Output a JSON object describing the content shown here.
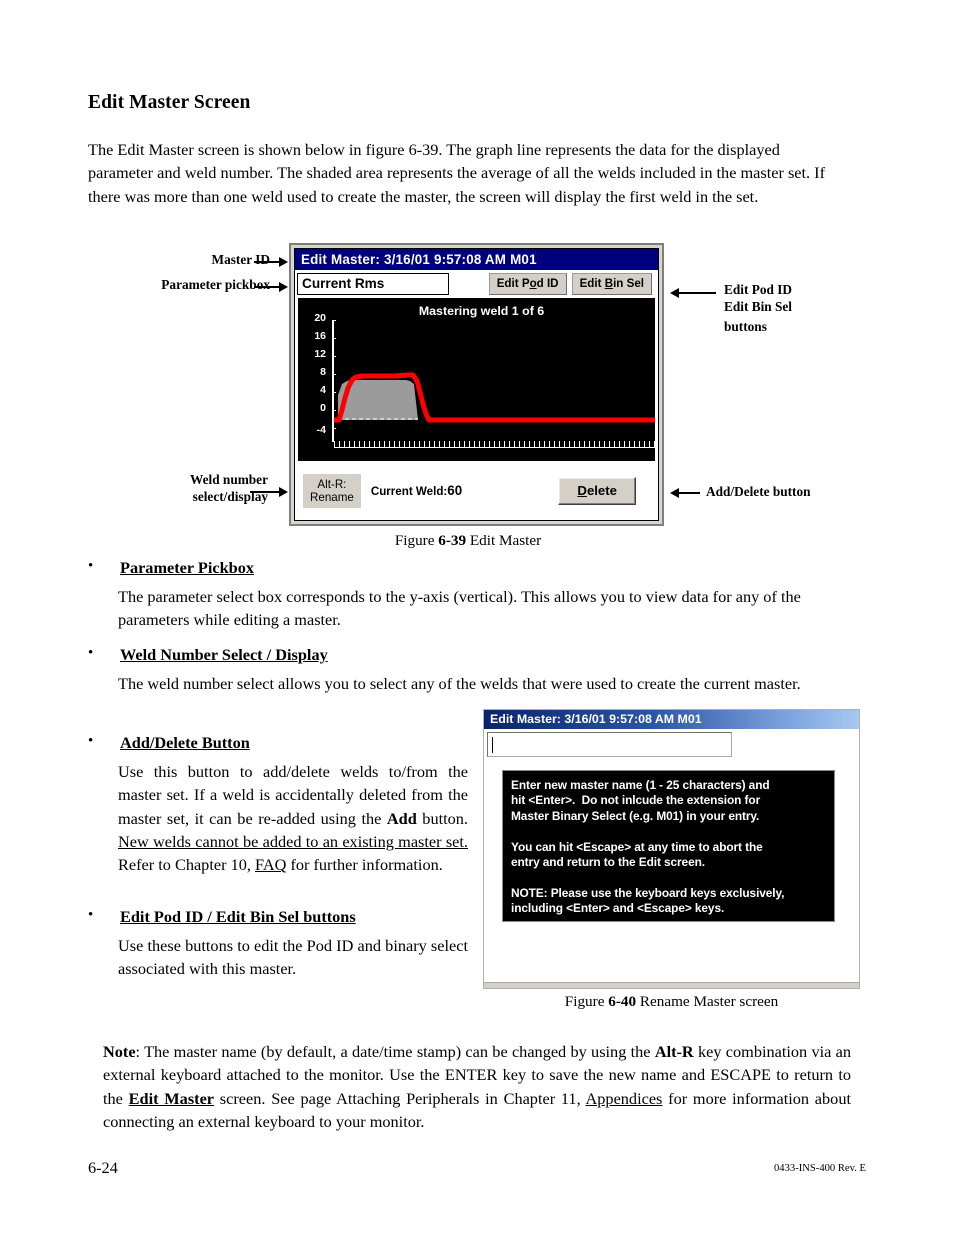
{
  "page": {
    "heading": "Edit Master Screen",
    "intro": "The Edit Master screen is shown below in figure 6-39. The graph line represents the data for the displayed parameter and weld number.  The shaded area represents the average of all the welds included in the master set. If there was more than one weld used to create the master, the screen will display the first weld in the set.",
    "footer_page": "6-24",
    "footer_doc": "0433-INS-400 Rev. E"
  },
  "callouts": {
    "master_id": "Master ID",
    "parameter_pickbox": "Parameter pickbox",
    "weld_number_line1": "Weld  number",
    "weld_number_line2": "select/display",
    "edit_pod_line1": "Edit Pod ID",
    "edit_pod_line2": "Edit Bin Sel",
    "edit_pod_line3": "buttons",
    "add_delete": "Add/Delete button"
  },
  "figure1": {
    "title": "Edit Master: 3/16/01 9:57:08 AM M01",
    "pickbox_value": "Current Rms",
    "btn_pod_pre": "Edit P",
    "btn_pod_key": "o",
    "btn_pod_post": "d ID",
    "btn_bin_pre": "Edit ",
    "btn_bin_key": "B",
    "btn_bin_post": "in Sel",
    "rename_line1": "Alt-R:",
    "rename_line2": "Rename",
    "current_weld_label": "Current Weld:",
    "current_weld_value": "60",
    "delete_key": "D",
    "delete_rest": "elete",
    "caption_prefix": "Figure ",
    "caption_number": "6-39",
    "caption_text": " Edit Master"
  },
  "chart_data": {
    "type": "line",
    "title": "Mastering weld 1 of 6",
    "xlabel": "",
    "ylabel": "",
    "ylim": [
      -6,
      21
    ],
    "yticks": [
      20,
      16,
      12,
      8,
      4,
      0,
      -4
    ],
    "ytick_labels": [
      "20",
      "16",
      "12",
      "8",
      "4",
      "0",
      "-4"
    ],
    "grid": false,
    "background": "#000000",
    "legend": "none",
    "series": [
      {
        "name": "weld trace",
        "color": "#ff0000",
        "x": [
          0,
          11,
          12,
          13,
          14,
          15,
          16,
          17,
          20,
          30,
          40,
          45,
          46,
          47,
          48,
          49,
          50,
          52,
          60,
          80,
          100
        ],
        "y": [
          -1.6,
          -1.6,
          -0.4,
          1.6,
          3.6,
          5.2,
          6.1,
          6.3,
          6.2,
          6.3,
          6.2,
          6.4,
          5.4,
          3.4,
          1.2,
          -0.6,
          -1.5,
          -1.6,
          -1.6,
          -1.6,
          -1.6
        ]
      },
      {
        "name": "master average (shaded)",
        "color": "#9b9b9b",
        "x": [
          13,
          15,
          17,
          25,
          35,
          44,
          46
        ],
        "y": [
          -1.6,
          5.0,
          5.6,
          5.6,
          5.6,
          5.6,
          -1.6
        ]
      }
    ]
  },
  "bullets": [
    {
      "heading": "Parameter Pickbox",
      "body": "The parameter select box corresponds to the y-axis (vertical). This allows you to view data for any of the parameters while editing a master."
    },
    {
      "heading": "Weld Number Select / Display",
      "body": "The weld number select allows you to select any of the welds that were used to create the current master."
    },
    {
      "heading": "Add/Delete Button",
      "body_part1": "Use this button to add/delete welds to/from the master set. If a weld is accidentally deleted from the master set, it can be re-added using the ",
      "body_bold_add": "Add",
      "body_part2": " button. ",
      "body_underline": "New welds cannot be added to an existing master set.",
      "body_part3": " Refer to Chapter 10, ",
      "body_underline2": "FAQ",
      "body_part4": " for further information."
    },
    {
      "heading": "Edit Pod ID / Edit Bin Sel buttons",
      "body": "Use these buttons to edit the Pod ID and binary select associated with this master."
    }
  ],
  "figure2": {
    "title": "Edit Master: 3/16/01 9:57:08 AM M01",
    "input_value": "",
    "message": "Enter new master name (1 - 25 characters) and\nhit <Enter>.  Do not inlcude the extension for\nMaster Binary Select (e.g. M01) in your entry.\n\nYou can hit <Escape> at any time to abort the\nentry and return to the Edit screen.\n\nNOTE: Please use the keyboard keys exclusively,\nincluding <Enter> and <Escape> keys.",
    "caption_prefix": "Figure ",
    "caption_number": "6-40",
    "caption_text": " Rename Master screen"
  },
  "note": {
    "label": "Note",
    "part1": ": The master name (by default, a date/time stamp) can be changed by using the ",
    "bold_altr": "Alt-R",
    "part2": " key combination via an external keyboard attached to the monitor. Use the ENTER key to save the new name and ESCAPE to return to the ",
    "bold_editmaster": "Edit Master",
    "part3": " screen. See page Attaching Peripherals in Chapter 11, ",
    "underline_appendices": "Appendices",
    "part4": " for more information about connecting an external keyboard to your monitor."
  }
}
